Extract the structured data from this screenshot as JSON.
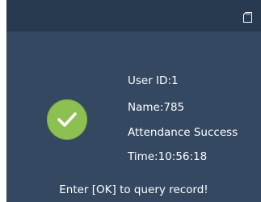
{
  "status": {
    "icon": "sd-card-icon"
  },
  "result": {
    "icon": "check-circle-icon",
    "color": "#8cc152",
    "user_id": "User ID:1",
    "name": "Name:785",
    "message": "Attendance Success",
    "time": "Time:10:56:18"
  },
  "hint": "Enter [OK] to query record!",
  "colors": {
    "background": "#344861",
    "top_bar": "#283a50",
    "text": "#ffffff"
  }
}
